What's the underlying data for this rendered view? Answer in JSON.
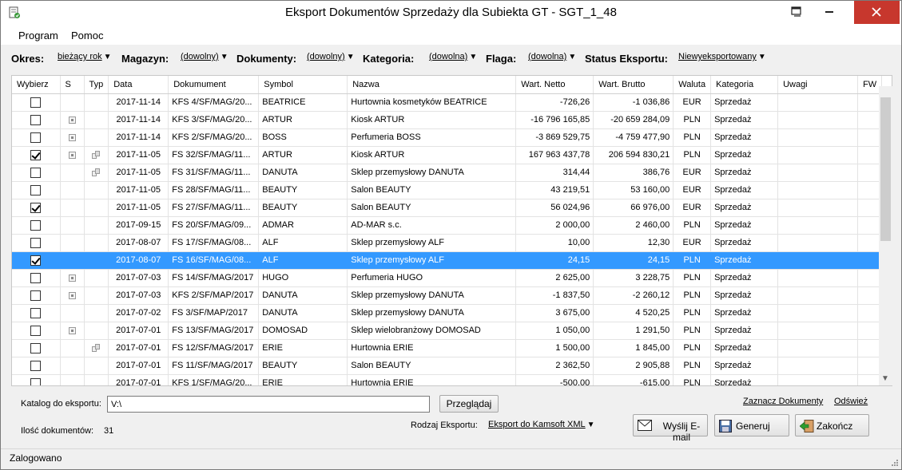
{
  "window": {
    "title": "Eksport Dokumentów Sprzedaży dla Subiekta GT - SGT_1_48"
  },
  "menu": {
    "program": "Program",
    "help": "Pomoc"
  },
  "filters": {
    "okres_label": "Okres:",
    "okres_value": "bieżący rok",
    "magazyn_label": "Magazyn:",
    "magazyn_value": "(dowolny)",
    "dokumenty_label": "Dokumenty:",
    "dokumenty_value": "(dowolny)",
    "kategoria_label": "Kategoria:",
    "kategoria_value": "(dowolna)",
    "flaga_label": "Flaga:",
    "flaga_value": "(dowolna)",
    "status_label": "Status Eksportu:",
    "status_value": "Niewyeksportowany"
  },
  "grid": {
    "columns": [
      "Wybierz",
      "S",
      "Typ",
      "Data",
      "Dokumument",
      "Symbol",
      "Nazwa",
      "Wart. Netto",
      "Wart. Brutto",
      "Waluta",
      "Kategoria",
      "Uwagi",
      "FW"
    ],
    "rows": [
      {
        "checked": false,
        "s": false,
        "typ": false,
        "data": "2017-11-14",
        "dok": "KFS 4/SF/MAG/20...",
        "symbol": "BEATRICE",
        "nazwa": "Hurtownia kosmetyków BEATRICE",
        "netto": "-726,26",
        "brutto": "-1 036,86",
        "waluta": "EUR",
        "kategoria": "Sprzedaż",
        "uwagi": "",
        "fw": ""
      },
      {
        "checked": false,
        "s": true,
        "typ": false,
        "data": "2017-11-14",
        "dok": "KFS 3/SF/MAG/20...",
        "symbol": "ARTUR",
        "nazwa": "Kiosk ARTUR",
        "netto": "-16 796 165,85",
        "brutto": "-20 659 284,09",
        "waluta": "PLN",
        "kategoria": "Sprzedaż",
        "uwagi": "",
        "fw": ""
      },
      {
        "checked": false,
        "s": true,
        "typ": false,
        "data": "2017-11-14",
        "dok": "KFS 2/SF/MAG/20...",
        "symbol": "BOSS",
        "nazwa": "Perfumeria BOSS",
        "netto": "-3 869 529,75",
        "brutto": "-4 759 477,90",
        "waluta": "PLN",
        "kategoria": "Sprzedaż",
        "uwagi": "",
        "fw": ""
      },
      {
        "checked": true,
        "s": true,
        "typ": true,
        "data": "2017-11-05",
        "dok": "FS 32/SF/MAG/11...",
        "symbol": "ARTUR",
        "nazwa": "Kiosk ARTUR",
        "netto": "167 963 437,78",
        "brutto": "206 594 830,21",
        "waluta": "PLN",
        "kategoria": "Sprzedaż",
        "uwagi": "",
        "fw": ""
      },
      {
        "checked": false,
        "s": false,
        "typ": true,
        "data": "2017-11-05",
        "dok": "FS 31/SF/MAG/11...",
        "symbol": "DANUTA",
        "nazwa": "Sklep przemysłowy DANUTA",
        "netto": "314,44",
        "brutto": "386,76",
        "waluta": "EUR",
        "kategoria": "Sprzedaż",
        "uwagi": "",
        "fw": ""
      },
      {
        "checked": false,
        "s": false,
        "typ": false,
        "data": "2017-11-05",
        "dok": "FS 28/SF/MAG/11...",
        "symbol": "BEAUTY",
        "nazwa": "Salon BEAUTY",
        "netto": "43 219,51",
        "brutto": "53 160,00",
        "waluta": "EUR",
        "kategoria": "Sprzedaż",
        "uwagi": "",
        "fw": ""
      },
      {
        "checked": true,
        "s": false,
        "typ": false,
        "data": "2017-11-05",
        "dok": "FS 27/SF/MAG/11...",
        "symbol": "BEAUTY",
        "nazwa": "Salon BEAUTY",
        "netto": "56 024,96",
        "brutto": "66 976,00",
        "waluta": "EUR",
        "kategoria": "Sprzedaż",
        "uwagi": "",
        "fw": ""
      },
      {
        "checked": false,
        "s": false,
        "typ": false,
        "data": "2017-09-15",
        "dok": "FS 20/SF/MAG/09...",
        "symbol": "ADMAR",
        "nazwa": "AD-MAR s.c.",
        "netto": "2 000,00",
        "brutto": "2 460,00",
        "waluta": "PLN",
        "kategoria": "Sprzedaż",
        "uwagi": "",
        "fw": ""
      },
      {
        "checked": false,
        "s": false,
        "typ": false,
        "data": "2017-08-07",
        "dok": "FS 17/SF/MAG/08...",
        "symbol": "ALF",
        "nazwa": "Sklep przemysłowy ALF",
        "netto": "10,00",
        "brutto": "12,30",
        "waluta": "EUR",
        "kategoria": "Sprzedaż",
        "uwagi": "",
        "fw": ""
      },
      {
        "checked": true,
        "s": false,
        "typ": false,
        "data": "2017-08-07",
        "dok": "FS 16/SF/MAG/08...",
        "symbol": "ALF",
        "nazwa": "Sklep przemysłowy ALF",
        "netto": "24,15",
        "brutto": "24,15",
        "waluta": "PLN",
        "kategoria": "Sprzedaż",
        "uwagi": "",
        "fw": "",
        "selected": true
      },
      {
        "checked": false,
        "s": true,
        "typ": false,
        "data": "2017-07-03",
        "dok": "FS 14/SF/MAG/2017",
        "symbol": "HUGO",
        "nazwa": "Perfumeria HUGO",
        "netto": "2 625,00",
        "brutto": "3 228,75",
        "waluta": "PLN",
        "kategoria": "Sprzedaż",
        "uwagi": "",
        "fw": ""
      },
      {
        "checked": false,
        "s": true,
        "typ": false,
        "data": "2017-07-03",
        "dok": "KFS 2/SF/MAP/2017",
        "symbol": "DANUTA",
        "nazwa": "Sklep przemysłowy DANUTA",
        "netto": "-1 837,50",
        "brutto": "-2 260,12",
        "waluta": "PLN",
        "kategoria": "Sprzedaż",
        "uwagi": "",
        "fw": ""
      },
      {
        "checked": false,
        "s": false,
        "typ": false,
        "data": "2017-07-02",
        "dok": "FS 3/SF/MAP/2017",
        "symbol": "DANUTA",
        "nazwa": "Sklep przemysłowy DANUTA",
        "netto": "3 675,00",
        "brutto": "4 520,25",
        "waluta": "PLN",
        "kategoria": "Sprzedaż",
        "uwagi": "",
        "fw": ""
      },
      {
        "checked": false,
        "s": true,
        "typ": false,
        "data": "2017-07-01",
        "dok": "FS 13/SF/MAG/2017",
        "symbol": "DOMOSAD",
        "nazwa": "Sklep wielobranżowy DOMOSAD",
        "netto": "1 050,00",
        "brutto": "1 291,50",
        "waluta": "PLN",
        "kategoria": "Sprzedaż",
        "uwagi": "",
        "fw": ""
      },
      {
        "checked": false,
        "s": false,
        "typ": true,
        "data": "2017-07-01",
        "dok": "FS 12/SF/MAG/2017",
        "symbol": "ERIE",
        "nazwa": "Hurtownia ERIE",
        "netto": "1 500,00",
        "brutto": "1 845,00",
        "waluta": "PLN",
        "kategoria": "Sprzedaż",
        "uwagi": "",
        "fw": ""
      },
      {
        "checked": false,
        "s": false,
        "typ": false,
        "data": "2017-07-01",
        "dok": "FS 11/SF/MAG/2017",
        "symbol": "BEAUTY",
        "nazwa": "Salon BEAUTY",
        "netto": "2 362,50",
        "brutto": "2 905,88",
        "waluta": "PLN",
        "kategoria": "Sprzedaż",
        "uwagi": "",
        "fw": ""
      },
      {
        "checked": false,
        "s": false,
        "typ": false,
        "data": "2017-07-01",
        "dok": "KFS 1/SF/MAG/20...",
        "symbol": "ERIE",
        "nazwa": "Hurtownia ERIE",
        "netto": "-500,00",
        "brutto": "-615,00",
        "waluta": "PLN",
        "kategoria": "Sprzedaż",
        "uwagi": "",
        "fw": ""
      }
    ]
  },
  "bottom": {
    "catalog_label": "Katalog do eksportu:",
    "catalog_value": "V:\\",
    "browse_button": "Przeglądaj",
    "select_docs_link": "Zaznacz Dokumenty",
    "refresh_link": "Odśwież",
    "count_label": "Ilość dokumentów:",
    "count_value": "31",
    "export_type_label": "Rodzaj Eksportu:",
    "export_type_value": "Eksport do Kamsoft XML",
    "email_button": "Wyślij E-mail",
    "generate_button": "Generuj",
    "finish_button": "Zakończ"
  },
  "status": {
    "text": "Zalogowano"
  },
  "colors": {
    "selection": "#3399ff",
    "close_button": "#c7372d"
  }
}
